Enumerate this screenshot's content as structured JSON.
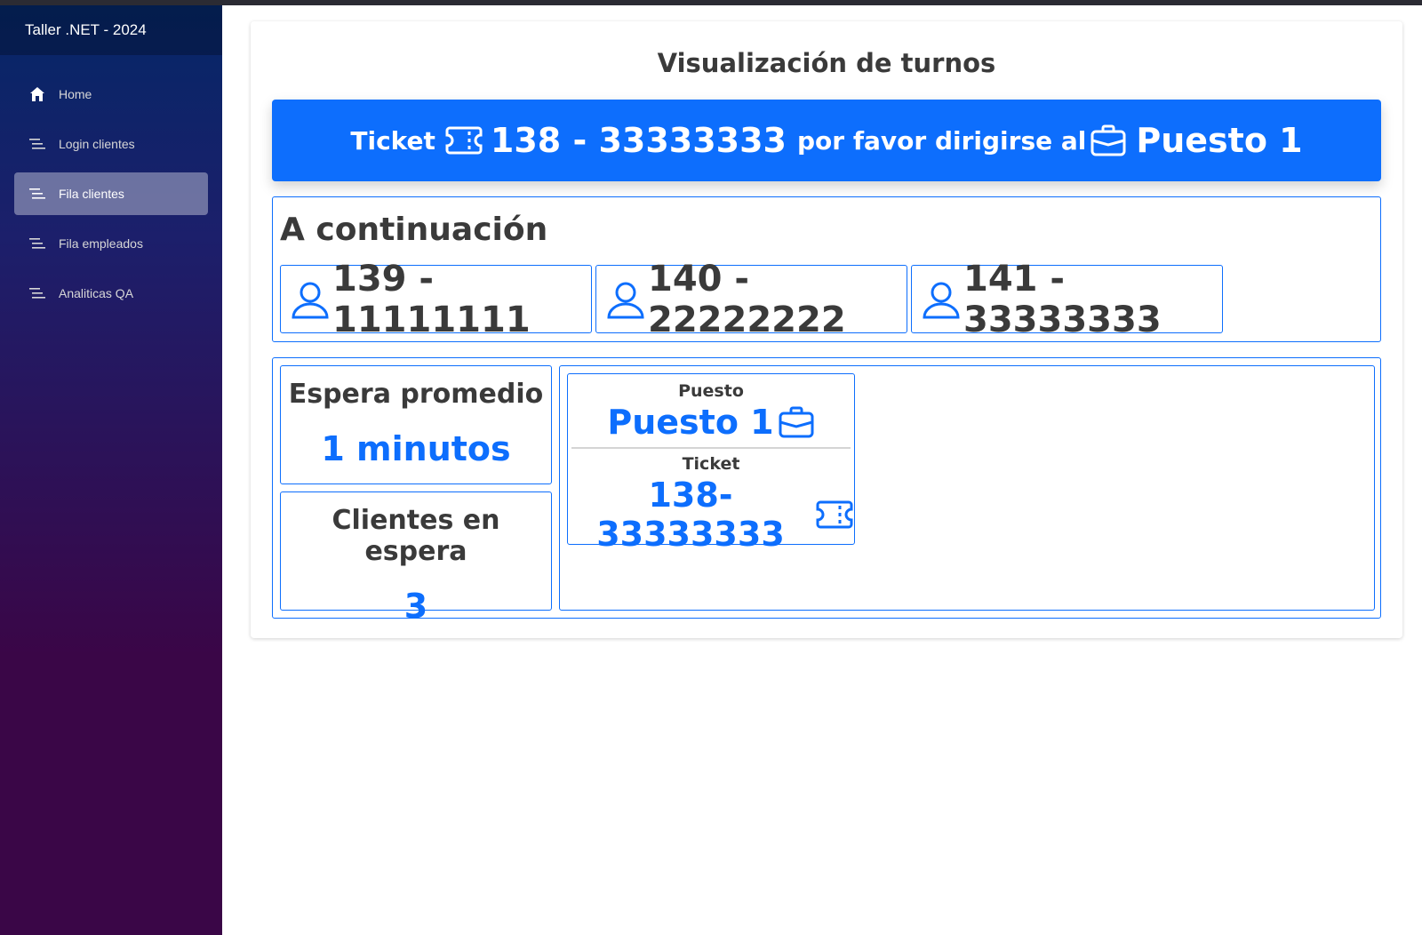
{
  "app": {
    "title": "Taller .NET - 2024"
  },
  "sidebar": {
    "items": [
      {
        "label": "Home",
        "icon": "home-icon",
        "active": false
      },
      {
        "label": "Login clientes",
        "icon": "list-icon",
        "active": false
      },
      {
        "label": "Fila clientes",
        "icon": "list-icon",
        "active": true
      },
      {
        "label": "Fila empleados",
        "icon": "list-icon",
        "active": false
      },
      {
        "label": "Analiticas QA",
        "icon": "list-icon",
        "active": false
      }
    ]
  },
  "main": {
    "title": "Visualización de turnos",
    "banner": {
      "ticket_label": "Ticket",
      "ticket_value": "138 - 33333333",
      "message": "por favor dirigirse al",
      "station": "Puesto 1"
    },
    "next": {
      "title": "A continuación",
      "items": [
        "139 - 11111111",
        "140 - 22222222",
        "141 - 33333333"
      ]
    },
    "stats": {
      "wait": {
        "label": "Espera promedio",
        "value": "1 minutos"
      },
      "waiting": {
        "label": "Clientes en espera",
        "value": "3"
      }
    },
    "stations": [
      {
        "station_label": "Puesto",
        "station_value": "Puesto 1",
        "ticket_label": "Ticket",
        "ticket_value": "138-33333333"
      }
    ]
  },
  "colors": {
    "accent": "#0d6efd",
    "text": "#3a3a3a"
  }
}
